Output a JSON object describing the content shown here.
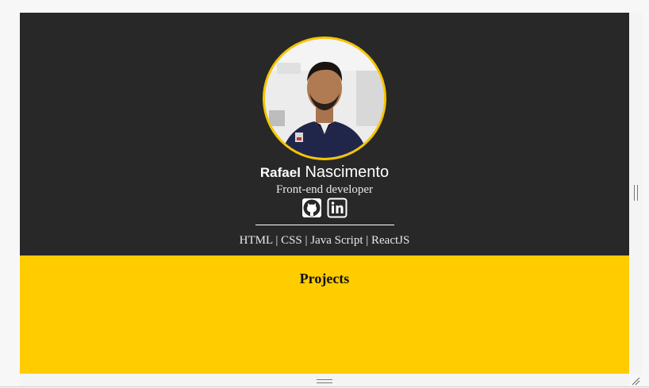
{
  "profile": {
    "first_name": "Rafael",
    "last_name": "Nascimento",
    "role": "Front-end developer",
    "avatar_icon": "profile-photo",
    "skills": "HTML | CSS | Java Script | ReactJS"
  },
  "socials": [
    {
      "icon": "github-icon"
    },
    {
      "icon": "linkedin-icon"
    }
  ],
  "projects": {
    "title": "Projects"
  },
  "colors": {
    "header_bg": "#282828",
    "accent": "#ffcc00",
    "avatar_border": "#f5c400"
  }
}
